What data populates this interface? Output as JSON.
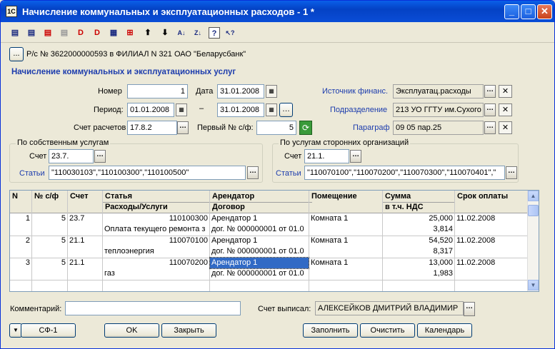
{
  "window": {
    "title": "Начисление коммунальных  и эксплуатационных расходов - 1 *",
    "icon": "1C"
  },
  "toolbar_icons": [
    "new-doc-icon",
    "new-copy-icon",
    "delete-icon",
    "mark-icon",
    "post-icon",
    "unpost-icon",
    "settings-icon",
    "insert-icon",
    "arrow-up-icon",
    "arrow-down-icon",
    "sort-asc-icon",
    "sort-desc-icon",
    "help-icon",
    "whatis-icon"
  ],
  "toolbar_glyphs": {
    "up": "⬆",
    "down": "⬇",
    "sort_asc": "A↓",
    "sort_desc": "Z↓",
    "help": "?",
    "whatis": "↖?"
  },
  "account": {
    "button": "...",
    "text": "Р/с № 3622000000593 в ФИЛИАЛ N 321 ОАО \"Беларусбанк\""
  },
  "header": {
    "section_title": "Начисление коммунальных и эксплуатационных услуг"
  },
  "form": {
    "number_label": "Номер",
    "number_value": "1",
    "date_label": "Дата",
    "date_value": "31.01.2008",
    "period_label": "Период:",
    "period_from": "01.01.2008",
    "period_dash": "–",
    "period_to": "31.01.2008",
    "account_label": "Счет расчетов",
    "account_value": "17.8.2",
    "first_sf_label": "Первый № с/ф:",
    "first_sf_value": "5",
    "source_label": "Источник финанс.",
    "source_value": "Эксплуатац.расходы",
    "division_label": "Подразделение",
    "division_value": "213 УО ГГТУ им.Сухого",
    "paragraph_label": "Параграф",
    "paragraph_value": "09 05 пар.25"
  },
  "own_group": {
    "title": "По собственным услугам",
    "account_label": "Счет",
    "account_value": "23.7.",
    "items_label": "Статьи",
    "items_value": "\"110030103\",\"110100300\",\"110100500\""
  },
  "third_group": {
    "title": "По услугам сторонних организаций",
    "account_label": "Счет",
    "account_value": "21.1.",
    "items_label": "Статьи",
    "items_value": "\"110070100\",\"110070200\",\"110070300\",\"110070401\",\""
  },
  "table": {
    "headers": [
      {
        "top": "N",
        "bottom": ""
      },
      {
        "top": "№ с/ф",
        "bottom": ""
      },
      {
        "top": "Счет",
        "bottom": ""
      },
      {
        "top": "Статья",
        "bottom": "Расходы/Услуги"
      },
      {
        "top": "Арендатор",
        "bottom": "Договор"
      },
      {
        "top": "Помещение",
        "bottom": ""
      },
      {
        "top": "Сумма",
        "bottom": "в т.ч. НДС"
      },
      {
        "top": "Срок оплаты",
        "bottom": ""
      }
    ],
    "rows": [
      {
        "n": "1",
        "sf": "5",
        "account": "23.7",
        "article": "110100300",
        "service": "Оплата текущего ремонта з",
        "tenant": "Арендатор 1",
        "contract": "дог. № 000000001 от 01.0",
        "room": "Комната 1",
        "sum": "25,000",
        "vat": "3,814",
        "due": "11.02.2008"
      },
      {
        "n": "2",
        "sf": "5",
        "account": "21.1",
        "article": "110070100",
        "service": "теплоэнергия",
        "tenant": "Арендатор 1",
        "contract": "дог. № 000000001 от 01.0",
        "room": "Комната 1",
        "sum": "54,520",
        "vat": "8,317",
        "due": "11.02.2008"
      },
      {
        "n": "3",
        "sf": "5",
        "account": "21.1",
        "article": "110070200",
        "service": "газ",
        "tenant": "Арендатор 1",
        "contract": "дог. № 000000001 от 01.0",
        "room": "Комната 1",
        "sum": "13,000",
        "vat": "1,983",
        "due": "11.02.2008"
      }
    ]
  },
  "footer": {
    "comment_label": "Комментарий:",
    "comment_value": "",
    "issuer_label": "Счет выписал:",
    "issuer_value": "АЛЕКСЕЙКОВ ДМИТРИЙ  ВЛАДИМИР",
    "btn_menu": "▼",
    "btn_sf": "СФ-1",
    "btn_ok": "OK",
    "btn_close": "Закрыть",
    "btn_fill": "Заполнить",
    "btn_clear": "Очистить",
    "btn_calendar": "Календарь"
  }
}
